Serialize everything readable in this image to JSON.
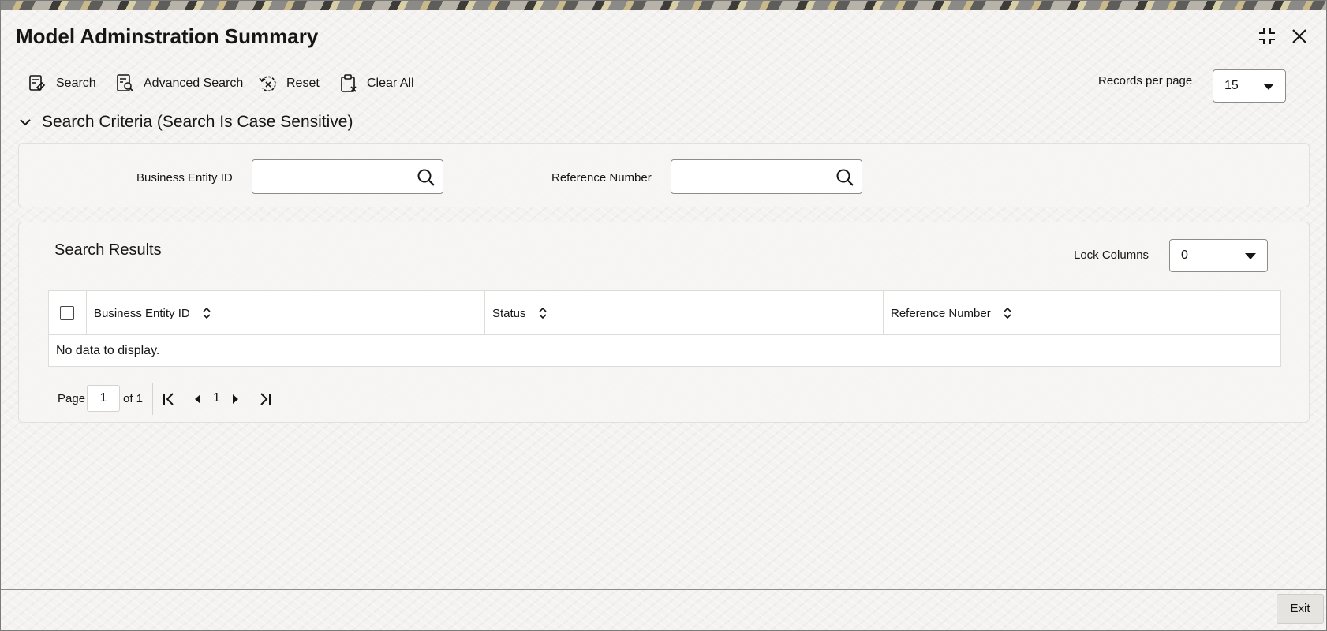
{
  "window": {
    "title": "Model Adminstration Summary",
    "controls": [
      {
        "name": "minimize-icon",
        "icon": "compress-icon"
      },
      {
        "name": "close-icon",
        "icon": "close-icon"
      }
    ]
  },
  "toolbar": {
    "search_label": "Search",
    "advanced_search_label": "Advanced Search",
    "reset_label": "Reset",
    "clear_all_label": "Clear All",
    "records_per_page_label": "Records per page",
    "records_per_page_value": "15"
  },
  "search_criteria": {
    "header": "Search Criteria (Search Is Case Sensitive)",
    "fields": {
      "business_entity_id": {
        "label": "Business Entity ID",
        "value": ""
      },
      "reference_number": {
        "label": "Reference Number",
        "value": ""
      }
    }
  },
  "search_results": {
    "title": "Search Results",
    "lock_columns_label": "Lock Columns",
    "lock_columns_value": "0",
    "columns": [
      "Business Entity ID",
      "Status",
      "Reference Number"
    ],
    "empty_message": "No data to display.",
    "pagination": {
      "page_label": "Page",
      "current_page": "1",
      "of_label": "of 1",
      "page_number": "1"
    }
  },
  "footer": {
    "exit_label": "Exit"
  },
  "colors": {
    "text": "#161513",
    "border": "#8f8c87",
    "panel": "#f6f5f3"
  }
}
